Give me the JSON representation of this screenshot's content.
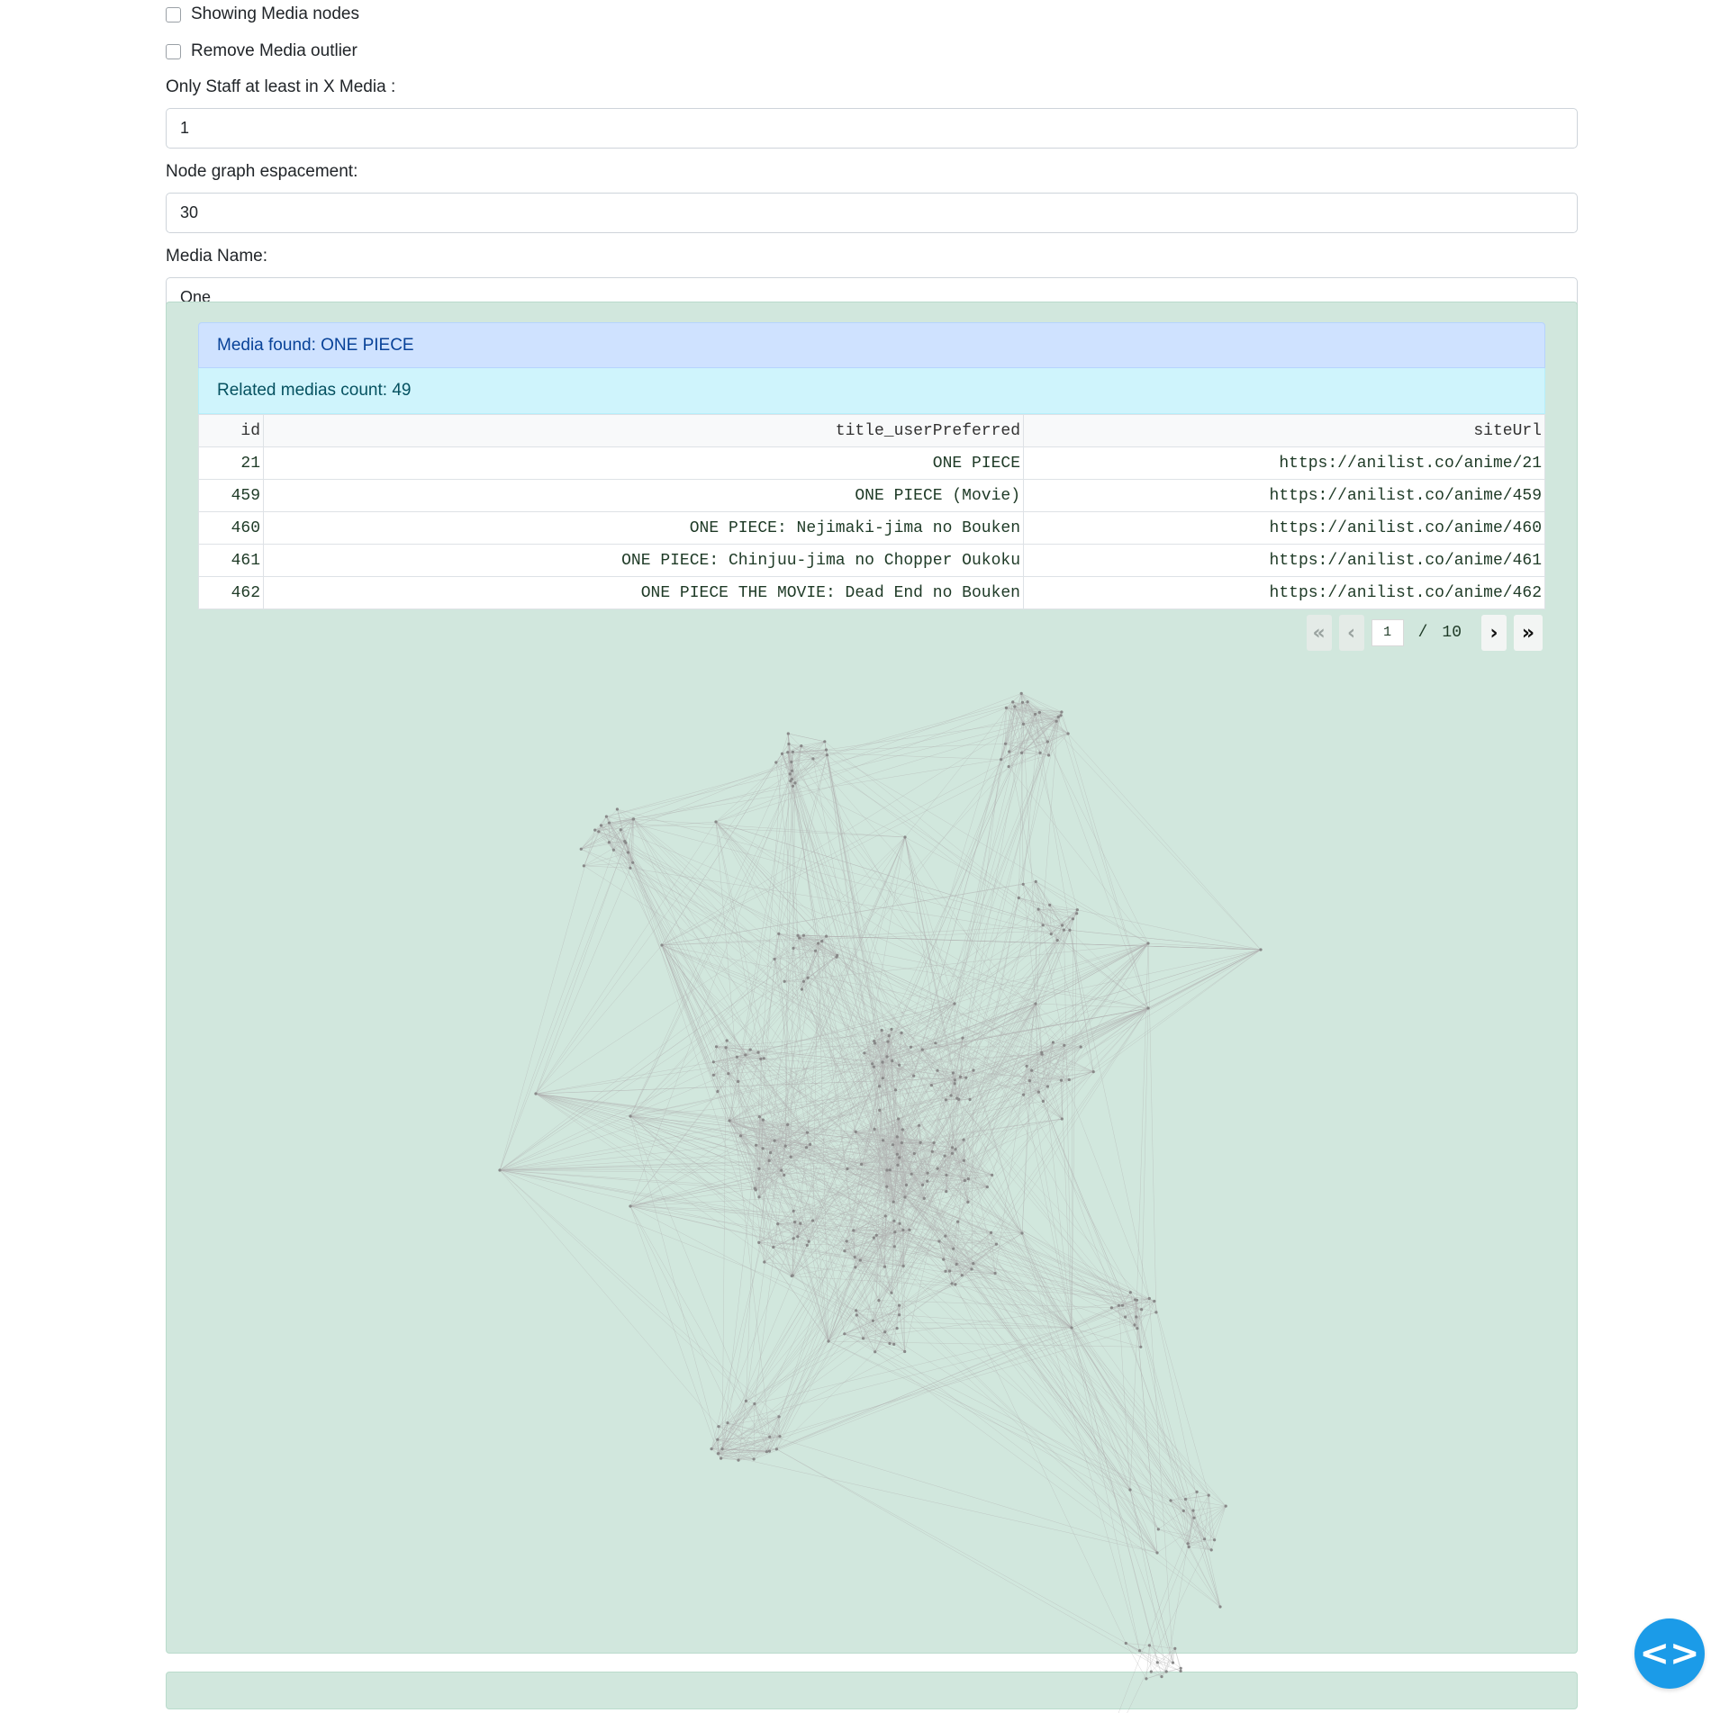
{
  "controls": {
    "show_media_nodes_label": "Showing Media nodes",
    "show_media_nodes_checked": false,
    "remove_outlier_label": "Remove Media outlier",
    "remove_outlier_checked": false,
    "min_staff_label": "Only Staff at least in X Media :",
    "min_staff_value": "1",
    "spacing_label": "Node graph espacement:",
    "spacing_value": "30",
    "media_name_label": "Media Name:",
    "media_name_value": "One"
  },
  "result": {
    "media_found": "Media found: ONE PIECE",
    "related_count": "Related medias count: 49",
    "table": {
      "headers": [
        "id",
        "title_userPreferred",
        "siteUrl"
      ],
      "rows": [
        [
          "21",
          "ONE PIECE",
          "https://anilist.co/anime/21"
        ],
        [
          "459",
          "ONE PIECE (Movie)",
          "https://anilist.co/anime/459"
        ],
        [
          "460",
          "ONE PIECE: Nejimaki-jima no Bouken",
          "https://anilist.co/anime/460"
        ],
        [
          "461",
          "ONE PIECE: Chinjuu-jima no Chopper Oukoku",
          "https://anilist.co/anime/461"
        ],
        [
          "462",
          "ONE PIECE THE MOVIE: Dead End no Bouken",
          "https://anilist.co/anime/462"
        ]
      ]
    },
    "pager": {
      "first_icon": "double-chevron-left-icon",
      "prev_icon": "chevron-left-icon",
      "next_icon": "chevron-right-icon",
      "last_icon": "double-chevron-right-icon",
      "current_page": "1",
      "separator": "/",
      "total_pages": "10"
    }
  },
  "graph": {
    "edge_color": "#b0b0b0",
    "node_color": "#888888"
  },
  "fab": {
    "icon": "code-brackets-icon"
  },
  "colors": {
    "panel_bg": "#d1e7dd",
    "alert_primary_bg": "#cfe2ff",
    "alert_info_bg": "#cff4fc",
    "fab_bg": "#1b9be8"
  }
}
